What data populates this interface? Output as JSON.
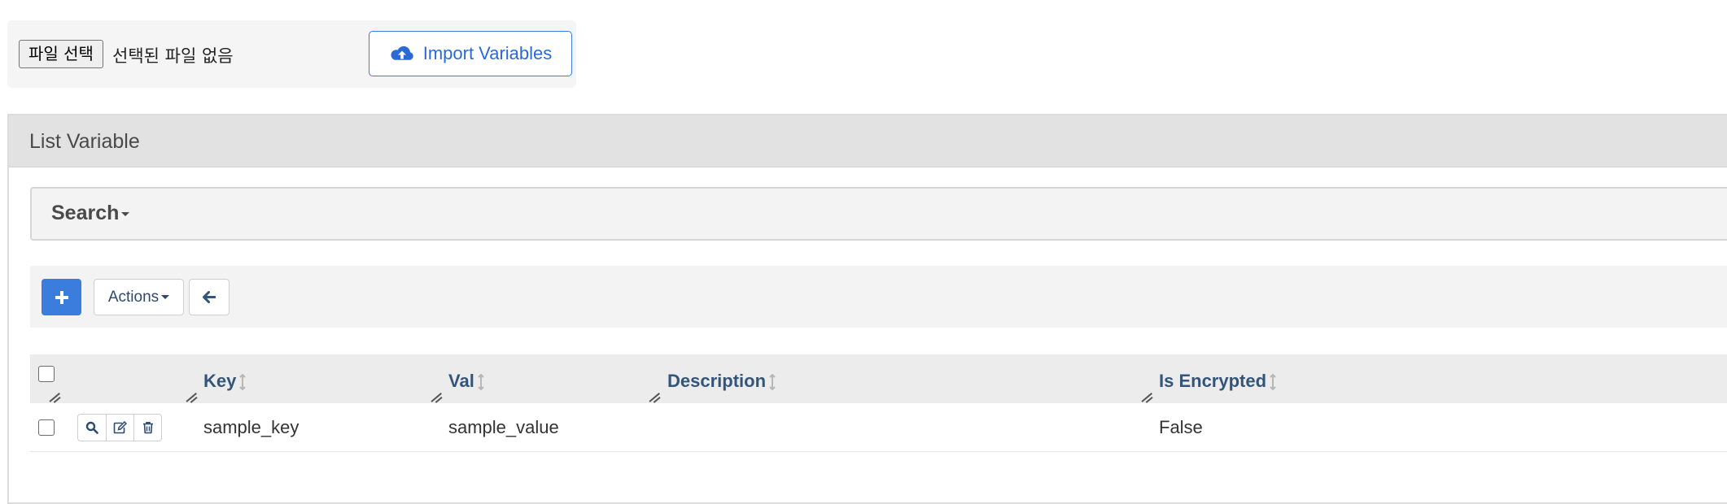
{
  "import_panel": {
    "file_button_label": "파일 선택",
    "file_status": "선택된 파일 없음",
    "import_button_label": "Import Variables",
    "import_icon": "cloud-upload-icon"
  },
  "list": {
    "title": "List Variable",
    "search_label": "Search",
    "toolbar": {
      "add_icon": "plus-icon",
      "actions_label": "Actions",
      "back_icon": "arrow-left-icon"
    },
    "columns": [
      "Key",
      "Val",
      "Description",
      "Is Encrypted"
    ],
    "rows": [
      {
        "key": "sample_key",
        "val": "sample_value",
        "description": "",
        "is_encrypted": "False",
        "row_action_icons": [
          "search-icon",
          "edit-icon",
          "trash-icon"
        ]
      }
    ]
  },
  "colors": {
    "primary": "#3b7ddd",
    "header_text": "#34557a",
    "panel_bg": "#f3f3f3",
    "header_bg": "#e2e2e2"
  }
}
